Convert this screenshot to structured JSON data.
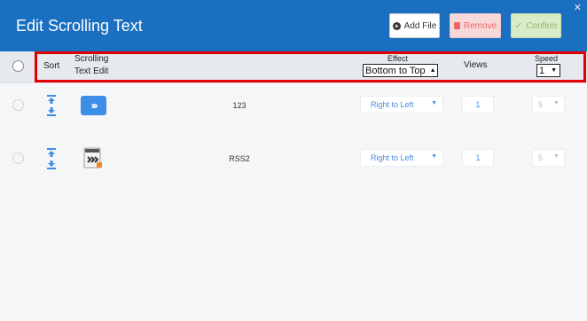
{
  "header": {
    "title": "Edit Scrolling Text",
    "buttons": {
      "add_file": "Add File",
      "remove": "Remove",
      "confirm": "Confirm"
    }
  },
  "columns": {
    "sort": "Sort",
    "scrolling_line1": "Scrolling",
    "scrolling_line2": "Text Edit",
    "effect": "Effect",
    "effect_value": "Bottom to Top",
    "views": "Views",
    "speed": "Speed",
    "speed_value": "1"
  },
  "rows": [
    {
      "name": "123",
      "thumb": "scroll-arrows-icon",
      "effect": "Right to Left",
      "views": "1",
      "speed": "5"
    },
    {
      "name": "RSS2",
      "thumb": "rss-file-icon",
      "effect": "Right to Left",
      "views": "1",
      "speed": "5"
    }
  ],
  "colors": {
    "header_bg": "#1a6fc0",
    "highlight": "#e10000",
    "accent_blue": "#4a8ce0"
  }
}
